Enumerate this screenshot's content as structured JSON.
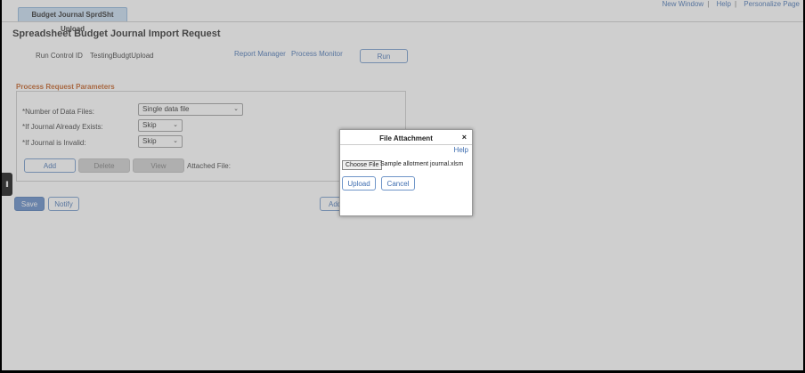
{
  "header": {
    "links": [
      "New Window",
      "Help",
      "Personalize Page"
    ],
    "tab": "Budget Journal SprdSht Upload"
  },
  "page": {
    "title": "Spreadsheet Budget Journal Import Request",
    "run_control_label": "Run Control ID",
    "run_control_value": "TestingBudgtUpload",
    "report_manager": "Report Manager",
    "process_monitor": "Process Monitor",
    "run_button": "Run"
  },
  "params": {
    "section_title": "Process Request Parameters",
    "num_files_label": "*Number of Data Files:",
    "num_files_value": "Single data file",
    "exists_label": "*If Journal Already Exists:",
    "exists_value": "Skip",
    "invalid_label": "*If Journal is Invalid:",
    "invalid_value": "Skip",
    "add_button": "Add",
    "delete_button": "Delete",
    "view_button": "View",
    "attached_file_label": "Attached File:"
  },
  "footer": {
    "save_button": "Save",
    "notify_button": "Notify",
    "add_partial": "Add"
  },
  "dialog": {
    "title": "File Attachment",
    "close": "×",
    "help": "Help",
    "choose_file": "Choose File",
    "file_name": "Sample allotment journal.xlsm",
    "upload_button": "Upload",
    "cancel_button": "Cancel"
  },
  "colors": {
    "link": "#3e6db0",
    "section_title": "#c05a1c",
    "primary_button": "#5b85c4"
  }
}
